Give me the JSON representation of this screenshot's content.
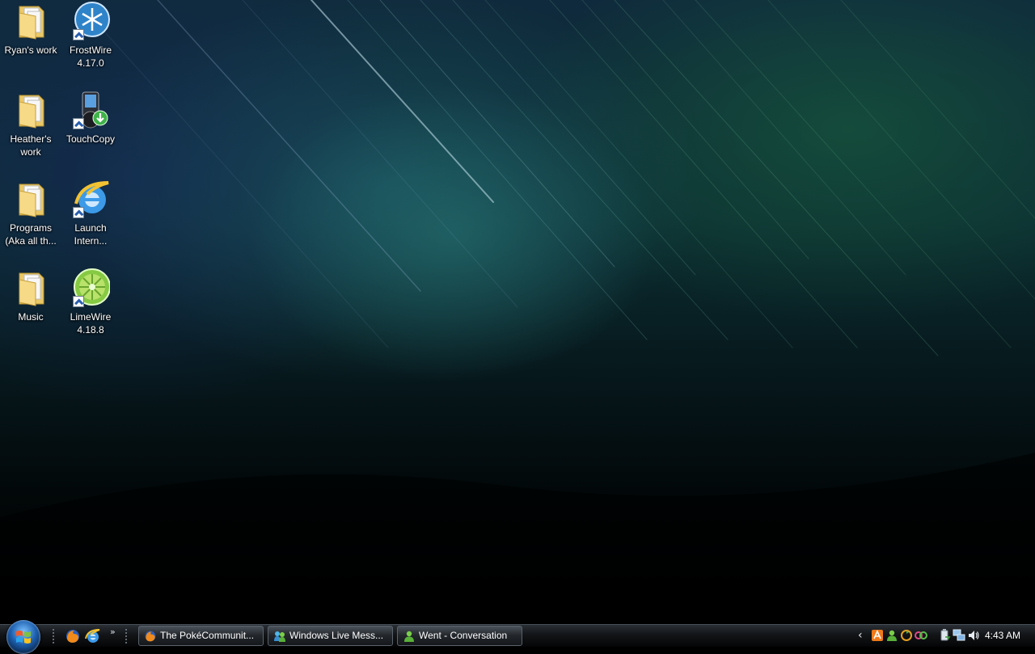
{
  "desktop": {
    "icons": [
      {
        "label": "Ryan's work",
        "icon": "folder-icon"
      },
      {
        "label": "FrostWire\n4.17.0",
        "icon": "frostwire-icon"
      },
      {
        "label": "Heather's\nwork",
        "icon": "folder-icon"
      },
      {
        "label": "TouchCopy",
        "icon": "touchcopy-icon"
      },
      {
        "label": "Programs\n(Aka all th...",
        "icon": "folder-icon"
      },
      {
        "label": "Launch\nIntern...",
        "icon": "internet-explorer-icon"
      },
      {
        "label": "Music",
        "icon": "folder-icon"
      },
      {
        "label": "LimeWire\n4.18.8",
        "icon": "limewire-icon"
      }
    ]
  },
  "taskbar": {
    "quick_launch": [
      "firefox-icon",
      "internet-explorer-icon"
    ],
    "quick_launch_more": "»",
    "buttons": [
      {
        "label": "The PokéCommunit...",
        "icon": "firefox-icon"
      },
      {
        "label": "Windows Live Mess...",
        "icon": "messenger-icon"
      },
      {
        "label": "Went - Conversation",
        "icon": "messenger-contact-icon"
      }
    ],
    "tray_chevron": "‹",
    "tray_icons": [
      "avast-icon",
      "messenger-status-icon",
      "sync-icon",
      "connection-icon",
      "usb-safely-remove-icon",
      "network-icon",
      "volume-icon"
    ],
    "clock": "4:43 AM"
  },
  "colors": {
    "folder": "#f3d27a",
    "taskbar": "#121417",
    "ie_blue": "#1f7de0",
    "limewire_green": "#7cc43a"
  }
}
